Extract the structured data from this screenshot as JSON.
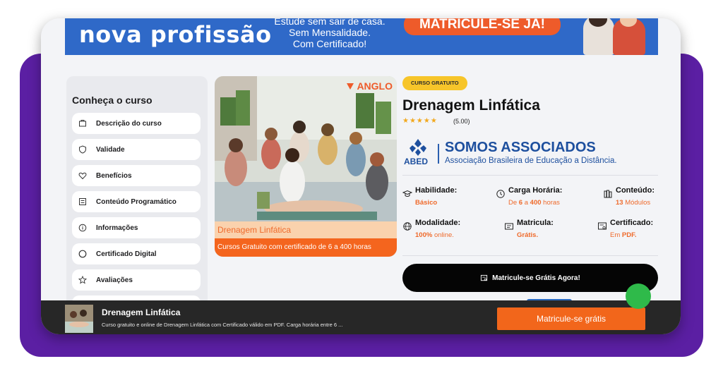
{
  "banner": {
    "headline": "nova profissão",
    "sub_lines": [
      "Estude sem sair de casa.",
      "Sem Mensalidade.",
      "Com Certificado!"
    ],
    "cta": "MATRICULE-SE JÁ!"
  },
  "sidebar": {
    "title": "Conheça o curso",
    "items": [
      {
        "label": "Descrição do curso",
        "icon": "book-icon"
      },
      {
        "label": "Validade",
        "icon": "shield-icon"
      },
      {
        "label": "Benefícios",
        "icon": "heart-icon"
      },
      {
        "label": "Conteúdo Programático",
        "icon": "list-icon"
      },
      {
        "label": "Informações",
        "icon": "info-icon"
      },
      {
        "label": "Certificado Digital",
        "icon": "certificate-icon"
      },
      {
        "label": "Avaliações",
        "icon": "star-icon"
      }
    ]
  },
  "course_card": {
    "brand": "ANGLO",
    "label": "Drenagem Linfática",
    "sub": "Cursos Gratuito com certificado de 6 a 400 horas"
  },
  "course": {
    "badge": "CURSO GRATUITO",
    "title": "Drenagem Linfática",
    "stars": "★★★★★",
    "rating": "(5.00)"
  },
  "abed": {
    "short": "ABED",
    "title": "SOMOS ASSOCIADOS",
    "subtitle": "Associação Brasileira de Educação a Distância."
  },
  "info": {
    "habilidade": {
      "title": "Habilidade:",
      "value": "Básico"
    },
    "carga": {
      "title": "Carga Horária:",
      "pre": "De ",
      "min": "6",
      "mid": " a ",
      "max": "400",
      "post": " horas"
    },
    "conteudo": {
      "title": "Conteúdo:",
      "count": "13",
      "rest": " Módulos"
    },
    "modalidade": {
      "title": "Modalidade:",
      "pct": "100%",
      "rest": " online."
    },
    "matricula": {
      "title": "Matricula:",
      "value": "Grátis."
    },
    "certificado": {
      "title": "Certificado:",
      "pre": "Em ",
      "value": "PDF."
    }
  },
  "cta": {
    "label": "Matricule-se Grátis Agora!"
  },
  "sticky": {
    "title": "Drenagem Linfática",
    "desc": "Curso gratuito e online de Drenagem Linfática com Certificado válido em PDF. Carga horária entre 6 ...",
    "button": "Matricule-se grátis"
  },
  "colors": {
    "accent": "#f2661b",
    "purple": "#5b1fa3",
    "badge": "#f7c52a",
    "brand_blue": "#1d4f9e"
  }
}
